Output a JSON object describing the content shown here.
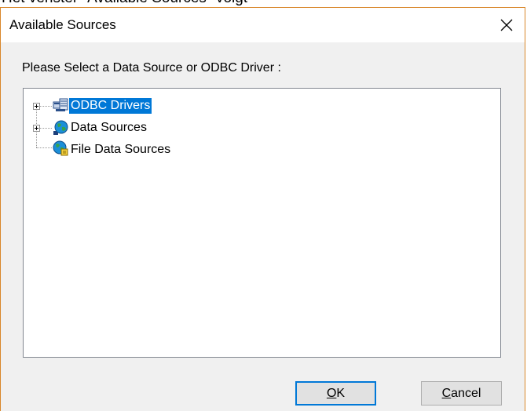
{
  "caption": "Het venster \"Available Sources\" volgt",
  "dialog": {
    "title": "Available Sources",
    "close_symbol": "✕",
    "prompt": "Please Select a Data Source or ODBC Driver :"
  },
  "tree": {
    "items": [
      {
        "label": "ODBC Drivers",
        "icon": "odbc-drivers-icon",
        "expandable": true,
        "selected": true
      },
      {
        "label": "Data Sources",
        "icon": "globe-icon",
        "expandable": true,
        "selected": false
      },
      {
        "label": "File Data Sources",
        "icon": "file-globe-icon",
        "expandable": false,
        "selected": false
      }
    ]
  },
  "buttons": {
    "ok": {
      "mnemonic": "O",
      "rest": "K"
    },
    "cancel": {
      "mnemonic": "C",
      "rest": "ancel"
    }
  },
  "colors": {
    "selection": "#0078d7",
    "window_border": "#d9872a",
    "dialog_bg": "#f0f0f0"
  }
}
